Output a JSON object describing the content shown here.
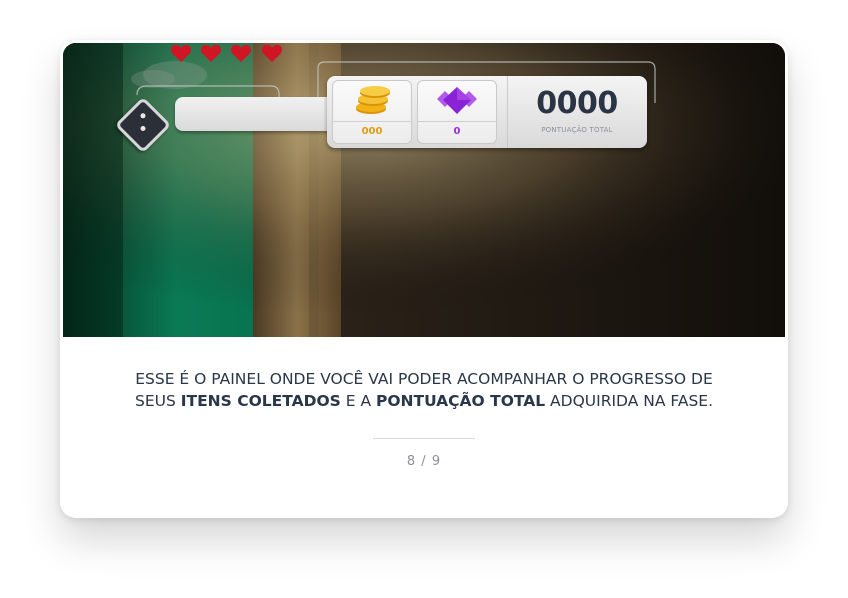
{
  "hud": {
    "hearts": 4,
    "coins_count": "000",
    "gems_count": "0",
    "score_value": "0000",
    "score_label": "PONTUAÇÃO TOTAL",
    "colors": {
      "heart": "#d01524",
      "coin": "#f2b114",
      "gem": "#8a22d6",
      "coin_text": "#e39b13",
      "gem_text": "#9a2bd8",
      "score_text": "#2a3444"
    }
  },
  "caption": {
    "line1": "ESSE É O PAINEL ONDE VOCÊ VAI PODER ACOMPANHAR O PROGRESSO DE",
    "line2_pre": "SEUS ",
    "line2_bold1": "ITENS COLETADOS",
    "line2_mid": " E A ",
    "line2_bold2": "PONTUAÇÃO TOTAL",
    "line2_post": " ADQUIRIDA NA FASE."
  },
  "pager": "8 / 9"
}
